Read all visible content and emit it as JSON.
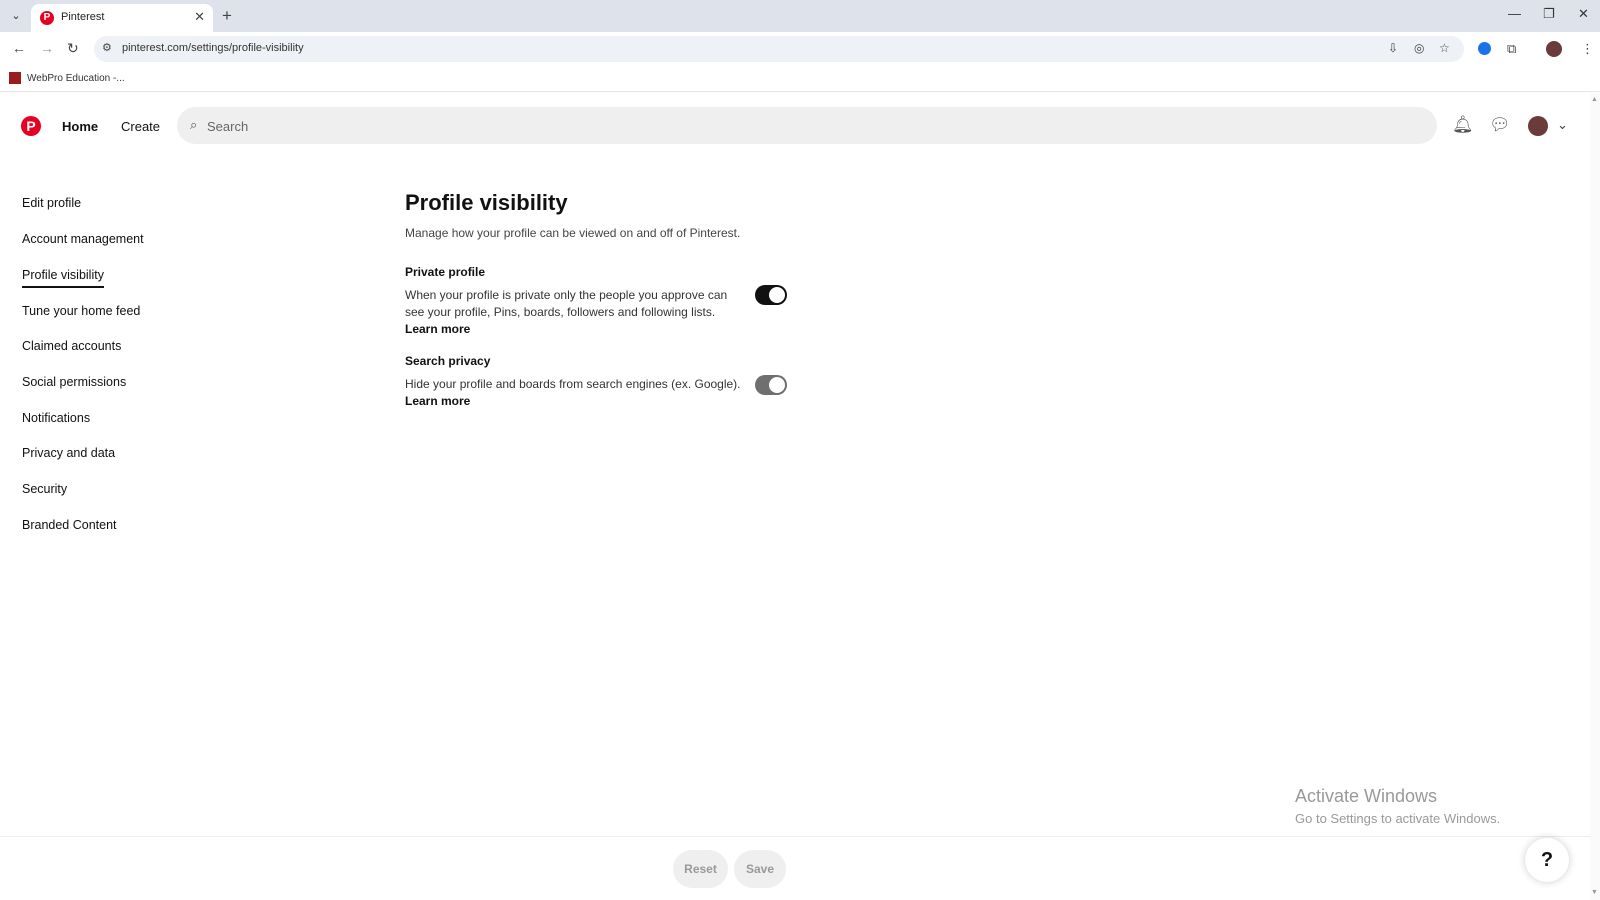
{
  "browser": {
    "tab_title": "Pinterest",
    "url": "pinterest.com/settings/profile-visibility",
    "bookmark": "WebPro Education -..."
  },
  "header": {
    "home_label": "Home",
    "create_label": "Create",
    "search_placeholder": "Search"
  },
  "sidebar": {
    "items": [
      {
        "label": "Edit profile"
      },
      {
        "label": "Account management"
      },
      {
        "label": "Profile visibility"
      },
      {
        "label": "Tune your home feed"
      },
      {
        "label": "Claimed accounts"
      },
      {
        "label": "Social permissions"
      },
      {
        "label": "Notifications"
      },
      {
        "label": "Privacy and data"
      },
      {
        "label": "Security"
      },
      {
        "label": "Branded Content"
      }
    ],
    "active_index": 2
  },
  "main": {
    "title": "Profile visibility",
    "subtitle": "Manage how your profile can be viewed on and off of Pinterest.",
    "settings": [
      {
        "title": "Private profile",
        "description": "When your profile is private only the people you approve can see your profile, Pins, boards, followers and following lists.",
        "link": "Learn more",
        "enabled": true
      },
      {
        "title": "Search privacy",
        "description": "Hide your profile and boards from search engines (ex. Google).",
        "link": "Learn more",
        "enabled": true
      }
    ]
  },
  "footer": {
    "reset_label": "Reset",
    "save_label": "Save",
    "help_label": "?"
  },
  "watermark": {
    "title": "Activate Windows",
    "subtitle": "Go to Settings to activate Windows."
  },
  "colors": {
    "brand": "#e60023",
    "toggle_on": "#111111",
    "toggle_disabled": "#6f6f6f"
  }
}
